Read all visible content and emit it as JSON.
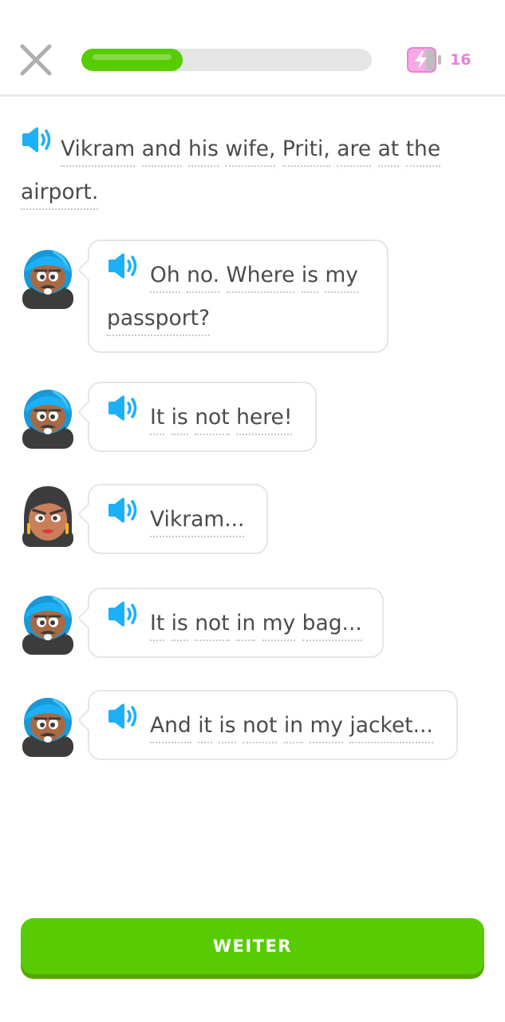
{
  "header": {
    "close_icon": "close-icon",
    "progress": 0.35,
    "progress_color": "#58cc02",
    "energy_icon": "battery-bolt-icon",
    "energy_count": "16",
    "energy_color": "#ec7fd6"
  },
  "intro": {
    "speaker_icon": "speaker-icon",
    "words": [
      "Vikram",
      "and",
      "his",
      "wife,",
      "Priti,",
      "are",
      "at",
      "the",
      "airport."
    ]
  },
  "dialogue": [
    {
      "speaker": "Vikram",
      "avatar_icon": "vikram-avatar-icon",
      "words": [
        "Oh",
        "no.",
        "Where",
        "is",
        "my",
        "passport?"
      ]
    },
    {
      "speaker": "Vikram",
      "avatar_icon": "vikram-avatar-icon",
      "words": [
        "It",
        "is",
        "not",
        "here!"
      ]
    },
    {
      "speaker": "Priti",
      "avatar_icon": "priti-avatar-icon",
      "words": [
        "Vikram..."
      ]
    },
    {
      "speaker": "Vikram",
      "avatar_icon": "vikram-avatar-icon",
      "words": [
        "It",
        "is",
        "not",
        "in",
        "my",
        "bag..."
      ]
    },
    {
      "speaker": "Vikram",
      "avatar_icon": "vikram-avatar-icon",
      "words": [
        "And",
        "it",
        "is",
        "not",
        "in",
        "my",
        "jacket..."
      ]
    }
  ],
  "footer": {
    "continue_label": "WEITER",
    "button_color": "#58cc02"
  }
}
